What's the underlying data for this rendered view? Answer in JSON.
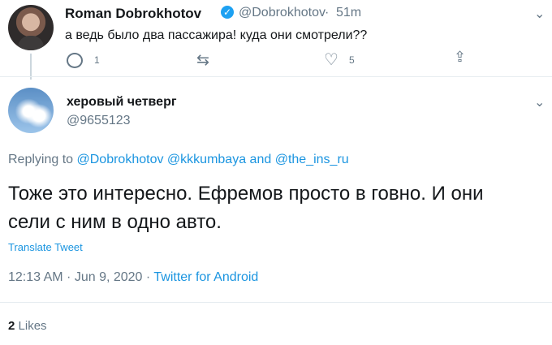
{
  "parent_tweet": {
    "name": "Roman Dobrokhotov",
    "handle": "@Dobrokhotov",
    "separator": "·",
    "time": "51m",
    "text": "а ведь было два пассажира! куда они смотрели??",
    "reply_count": "1",
    "like_count": "5",
    "verified": true
  },
  "reply_tweet": {
    "name": "херовый четверг",
    "handle": "@9655123",
    "replying_prefix": "Replying to",
    "mention_1": "@Dobrokhotov",
    "mention_2": "@kkkumbaya",
    "and_word": "and",
    "mention_3": "@the_ins_ru",
    "text_line_1": "Тоже это интересно. Ефремов просто в говно. И они",
    "text_line_2": "сели с ним в одно авто.",
    "translate": "Translate Tweet",
    "timestamp": "12:13 AM · Jun 9, 2020 ·",
    "source": "Twitter for Android",
    "likes_count": "2",
    "likes_label": "Likes"
  },
  "icons": {
    "chevron": "chevron-down-icon",
    "reply": "reply-icon",
    "retweet": "retweet-icon",
    "like": "heart-icon",
    "share": "share-icon",
    "verified": "verified-badge-icon"
  },
  "colors": {
    "link": "#1b95e0",
    "secondary_text": "#657786",
    "primary_text": "#14171a",
    "verified": "#1da1f2"
  }
}
